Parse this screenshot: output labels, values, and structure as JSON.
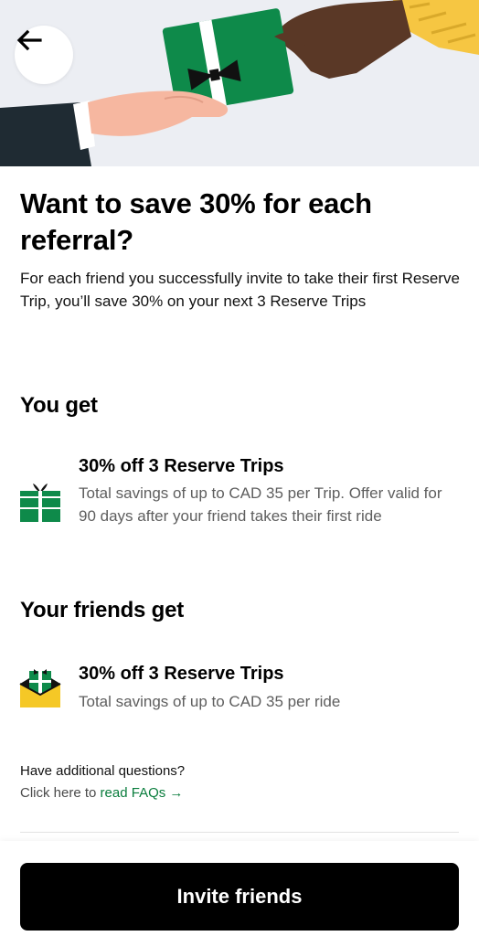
{
  "header": {
    "back_icon": "arrow-left-icon",
    "hero_image": "hands-exchanging-gift-illustration"
  },
  "main": {
    "title": "Want to save 30% for each referral?",
    "subtitle": "For each friend you successfully invite to take their first Reserve Trip, you’ll save 30% on your next 3 Reserve Trips"
  },
  "you_get": {
    "heading": "You get",
    "icon": "gift-icon",
    "title": "30% off 3 Reserve Trips",
    "description": "Total savings of up to CAD 35 per Trip. Offer valid for 90 days after your friend takes their first ride"
  },
  "friends_get": {
    "heading": "Your friends get",
    "icon": "gift-envelope-icon",
    "title": "30% off 3 Reserve Trips",
    "description": "Total savings of up to CAD 35 per ride"
  },
  "faq": {
    "question": "Have additional questions?",
    "prefix": "Click here to ",
    "link_label": "read FAQs →"
  },
  "footer": {
    "invite_label": "Invite friends"
  },
  "colors": {
    "primary_button": "#000000",
    "link_green": "#0a7d3d",
    "gift_green": "#0e8a4a",
    "envelope_yellow": "#f5c826",
    "hero_background": "#eceef3"
  }
}
